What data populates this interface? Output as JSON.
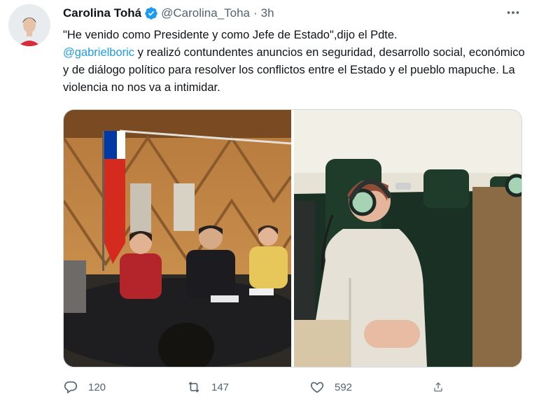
{
  "author": {
    "name": "Carolina Tohá",
    "handle": "@Carolina_Toha",
    "separator": "·",
    "time": "3h",
    "verified_color": "#1d9bf0"
  },
  "tweet": {
    "line1": "\"He venido como Presidente y como Jefe de Estado\",dijo el Pdte.",
    "mention": "@gabrielboric",
    "line2_rest": " y realizó contundentes anuncios en seguridad, desarrollo social, económico y de diálogo político para resolver los conflictos entre el Estado y el pueblo mapuche. La violencia no nos va a intimidar."
  },
  "media": {
    "count": 2,
    "left_description_icon": "photo",
    "right_description_icon": "photo"
  },
  "actions": {
    "replies": "120",
    "retweets": "147",
    "likes": "592"
  },
  "icons": {
    "reply": "reply-icon",
    "retweet": "retweet-icon",
    "like": "heart-icon",
    "share": "share-icon",
    "more": "more-icon",
    "verified": "verified-badge-icon"
  },
  "colors": {
    "text": "#0f1419",
    "secondary": "#536471",
    "link": "#1d9bf0"
  }
}
